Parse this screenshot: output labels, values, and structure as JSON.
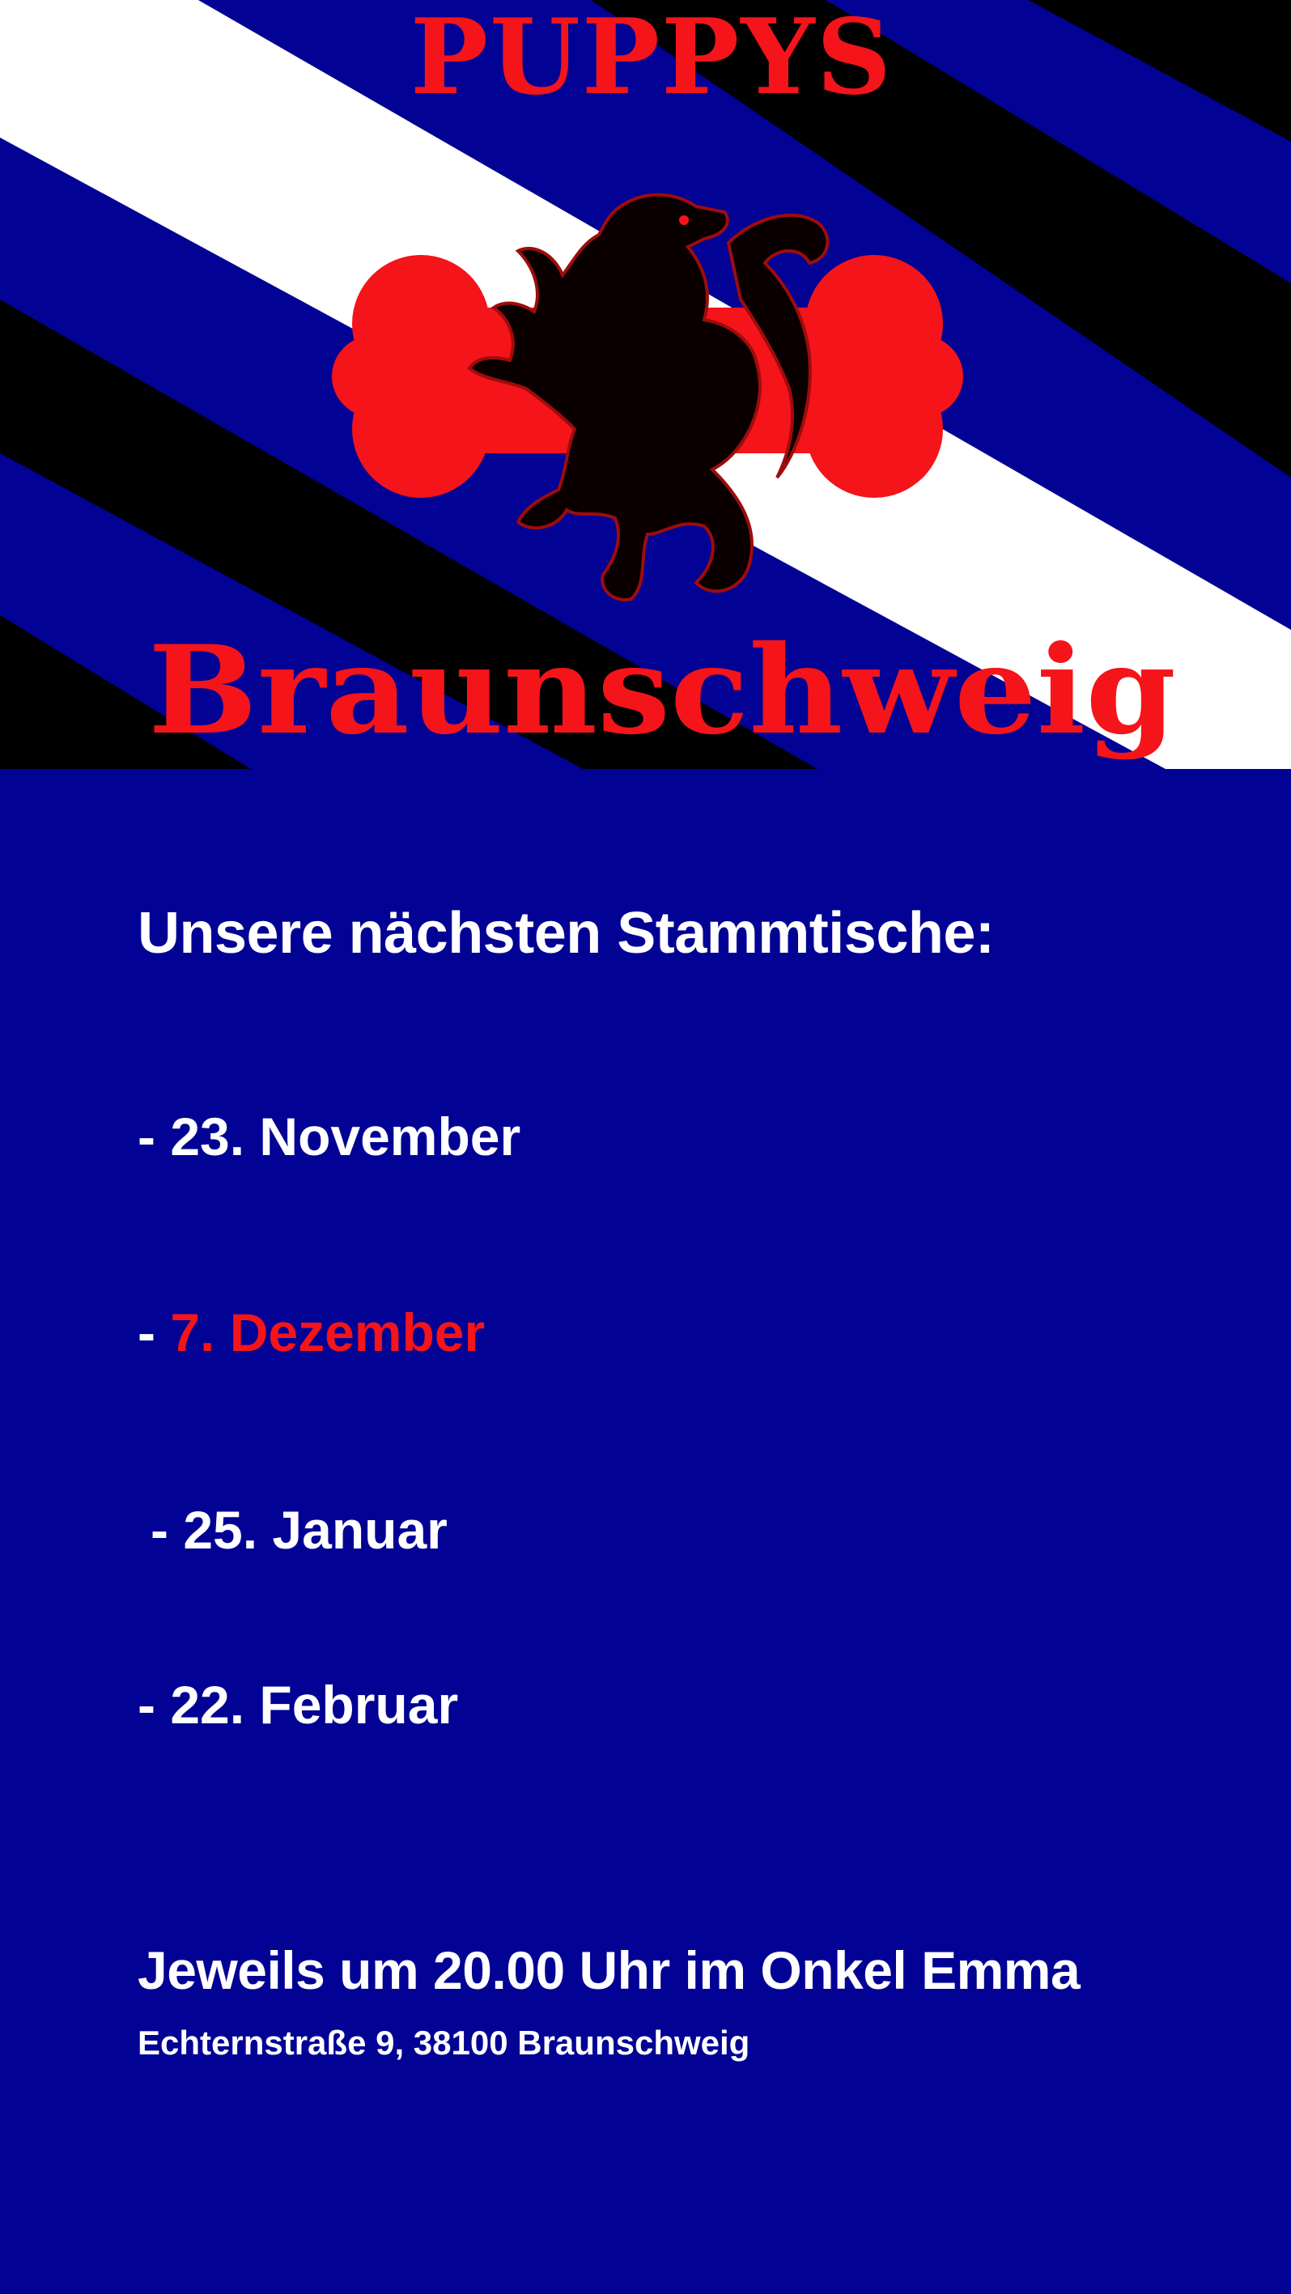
{
  "logo": {
    "top_text": "PUPPYS",
    "bottom_text": "Braunschweig",
    "emblem": "lion-on-bone-emblem"
  },
  "colors": {
    "background": "#020294",
    "stripe_white": "#ffffff",
    "stripe_black": "#000000",
    "accent_red": "#f4141a",
    "text": "#ffffff"
  },
  "schedule": {
    "heading": "Unsere nächsten Stammtische:",
    "dates": [
      {
        "dash": "- ",
        "value": "23. November",
        "highlight": false
      },
      {
        "dash": "- ",
        "value": "7. Dezember",
        "highlight": true
      },
      {
        "dash": "- ",
        "value": "25. Januar",
        "highlight": false
      },
      {
        "dash": "- ",
        "value": "22. Februar",
        "highlight": false
      }
    ]
  },
  "location": {
    "time_text": "Jeweils um 20.00 Uhr im Onkel Emma",
    "address": "Echternstraße 9, 38100 Braunschweig"
  }
}
